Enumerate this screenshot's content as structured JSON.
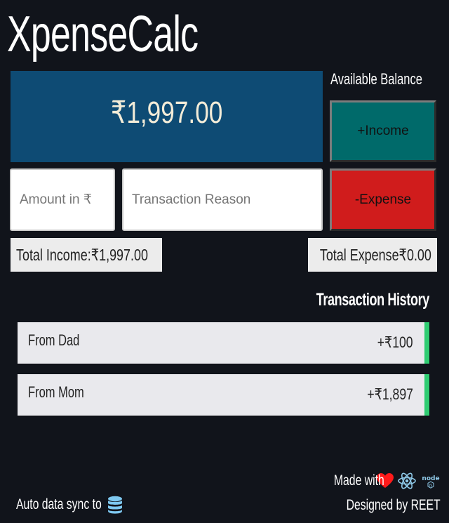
{
  "app": {
    "title": "XpenseCalc"
  },
  "balance": {
    "value": "₹1,997.00",
    "label": "Available Balance"
  },
  "buttons": {
    "income_label": "+Income",
    "expense_label": "-Expense"
  },
  "inputs": {
    "amount": {
      "value": "",
      "placeholder": "Amount in ₹"
    },
    "reason": {
      "value": "",
      "placeholder": "Transaction Reason"
    }
  },
  "totals": {
    "income": "Total Income:₹1,997.00",
    "expense": "Total Expense₹0.00"
  },
  "history": {
    "title": "Transaction History",
    "items": [
      {
        "reason": "From Dad",
        "amount": "+₹100",
        "type": "income"
      },
      {
        "reason": "From Mom",
        "amount": "+₹1,897",
        "type": "income"
      }
    ]
  },
  "footer": {
    "made_with": "Made with",
    "made_with_icons": [
      "heart-icon",
      "react-icon",
      "node-icon"
    ],
    "designed_by": "Designed by REET",
    "sync_label": "Auto data sync to",
    "sync_icon": "database-icon"
  },
  "colors": {
    "background": "#11141b",
    "balance_card": "#0e4b74",
    "income_button": "#006a6a",
    "expense_button": "#d01c1c",
    "income_indicator": "#2ecc71",
    "heart": "#ff1a1a",
    "database": "#7ec8f0"
  }
}
